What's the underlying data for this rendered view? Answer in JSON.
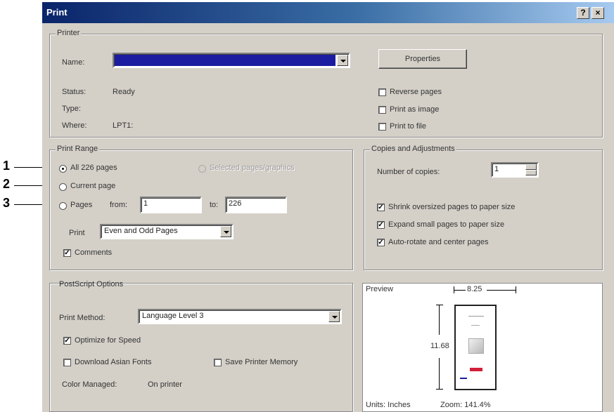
{
  "window": {
    "title": "Print",
    "help_glyph": "?",
    "close_glyph": "×"
  },
  "printer": {
    "group_label": "Printer",
    "name_label": "Name:",
    "name_value": "",
    "properties_button": "Properties",
    "status_label": "Status:",
    "status_value": "Ready",
    "type_label": "Type:",
    "type_value": "",
    "where_label": "Where:",
    "where_value": "LPT1:",
    "reverse_pages": {
      "label": "Reverse pages",
      "checked": false
    },
    "print_as_image": {
      "label": "Print as image",
      "checked": false
    },
    "print_to_file": {
      "label": "Print to file",
      "checked": false
    }
  },
  "print_range": {
    "group_label": "Print Range",
    "all_pages": {
      "label": "All 226 pages",
      "selected": true
    },
    "selected_pages": {
      "label": "Selected pages/graphics",
      "enabled": false
    },
    "current_page": {
      "label": "Current page",
      "selected": false
    },
    "pages": {
      "label": "Pages",
      "selected": false
    },
    "from_label": "from:",
    "from_value": "1",
    "to_label": "to:",
    "to_value": "226",
    "print_label": "Print",
    "print_value": "Even and Odd Pages",
    "comments": {
      "label": "Comments",
      "checked": true
    }
  },
  "copies": {
    "group_label": "Copies and Adjustments",
    "number_label": "Number of copies:",
    "number_value": "1",
    "shrink": {
      "label": "Shrink oversized pages to paper size",
      "checked": true
    },
    "expand": {
      "label": "Expand small pages to paper size",
      "checked": true
    },
    "autorotate": {
      "label": "Auto-rotate and center pages",
      "checked": true
    }
  },
  "postscript": {
    "group_label": "PostScript Options",
    "method_label": "Print Method:",
    "method_value": "Language Level 3",
    "optimize": {
      "label": "Optimize for Speed",
      "checked": true
    },
    "download_fonts": {
      "label": "Download Asian Fonts",
      "checked": false
    },
    "save_memory": {
      "label": "Save Printer Memory",
      "checked": false
    },
    "color_managed_label": "Color Managed:",
    "color_managed_value": "On printer"
  },
  "preview": {
    "label": "Preview",
    "width_value": "8.25",
    "height_value": "11.68",
    "units_label": "Units: Inches",
    "zoom_label": "Zoom: 141.4%"
  },
  "callouts": [
    "1",
    "2",
    "3"
  ],
  "colors": {
    "title_start": "#0a246a",
    "title_end": "#a6caf0",
    "name_selection": "#1c1ca0",
    "face": "#d4d0c8"
  }
}
